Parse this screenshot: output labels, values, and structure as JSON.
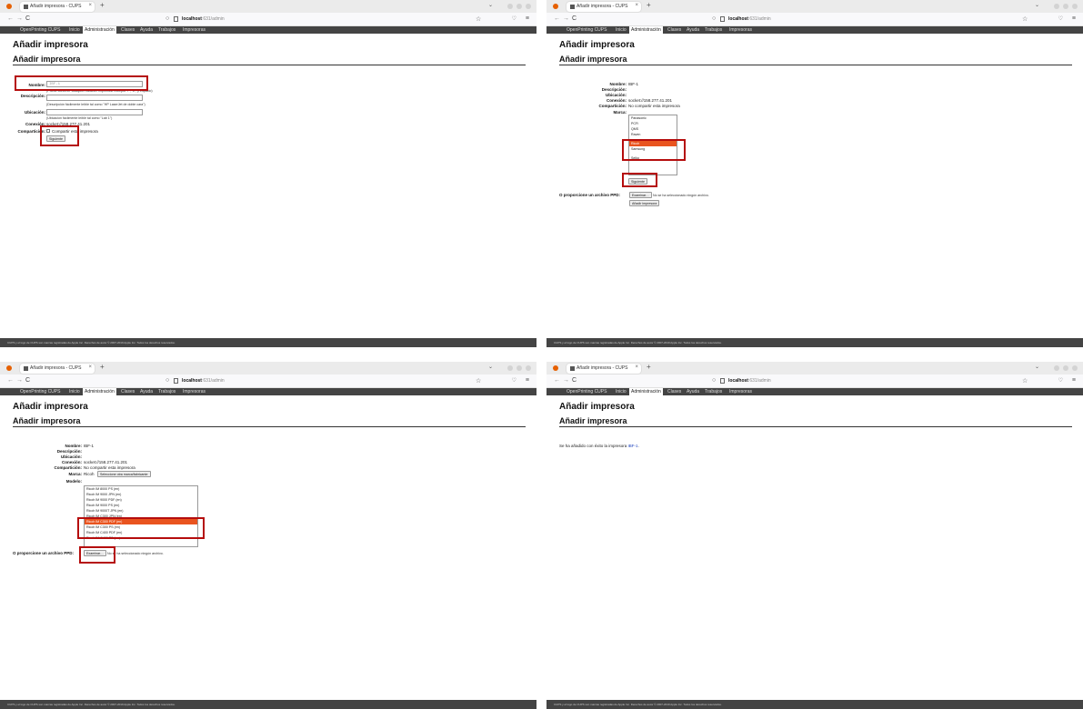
{
  "browser": {
    "tab_title": "Añadir impresora - CUPS",
    "tab_close": "×",
    "new_tab": "+",
    "tabs_menu": "⌄",
    "url_host": "localhost",
    "url_path": ":631/admin",
    "back": "←",
    "forward": "→",
    "reload": "C",
    "bookmark_star": "☆",
    "pocket": "♡",
    "menu": "≡"
  },
  "cups_nav": [
    "OpenPrinting CUPS",
    "Inicio",
    "Administración",
    "Clases",
    "Ayuda",
    "Trabajos",
    "Impresoras"
  ],
  "page": {
    "h1": "Añadir impresora",
    "h2": "Añadir impresora"
  },
  "labels": {
    "nombre": "Nombre:",
    "descripcion": "Descripción:",
    "ubicacion": "Ubicación:",
    "conexion": "Conexión:",
    "comparticion": "Compartición:",
    "marca": "Marca:",
    "modelo": "Modelo:",
    "ppd": "O proporcione un archivo PPD:"
  },
  "step1": {
    "nombre_value": "IBF-1",
    "nombre_hint": "(Puede contener cualquier carácter imprimible excepto \"/\", \"#\", y espacio)",
    "descripcion_hint": "(Descripción fácilmente leíble tal como \"HP LaserJet de doble cara\")",
    "ubicacion_hint": "(Ubicación fácilmente leíble tal como \"Lab 1\")",
    "conexion_value": "socket://158.277.41.201",
    "compartir_label": "Compartir esta impresora",
    "siguiente": "Siguiente"
  },
  "step2": {
    "nombre_value": "IBF-1",
    "conexion_value": "socket://158.277.41.201",
    "comparticion_value": "No compartir esta impresora",
    "marcas": [
      "Panasonic",
      "PCFi",
      "QMS",
      "Raven",
      "Ricoh",
      "Samsung",
      "Seiko"
    ],
    "marcas_selected": 4,
    "siguiente": "Siguiente",
    "examinar": "Examinar…",
    "no_file": "No se ha seleccionado ningún archivo.",
    "anadir": "Añadir impresora"
  },
  "step3": {
    "nombre_value": "IBF-1",
    "conexion_value": "socket://158.277.41.201",
    "comparticion_value": "No compartir esta impresora",
    "marca_value": "Ricoh",
    "otra_marca": "Seleccione otra marca/fabricante",
    "modelos": [
      "Ricoh IM 8000 PS (en)",
      "Ricoh IM 9000 JPN (en)",
      "Ricoh IM 9000 PDF (en)",
      "Ricoh IM 9000 PS (en)",
      "Ricoh IM 9000T JPN (en)",
      "Ricoh IM C300 JPN (en)",
      "Ricoh IM C300 PDF (en)",
      "Ricoh IM C300 PS (en)",
      "Ricoh IM C400 PDF (en)",
      "Ricoh IM C400 PS (en)"
    ],
    "modelos_selected": 6,
    "examinar": "Examinar…",
    "no_file": "No se ha seleccionado ningún archivo."
  },
  "step4": {
    "message_before": "Se ha añadido con éxito la impresora ",
    "printer_link": "IBF-1",
    "message_after": "."
  },
  "footer": "CUPS y el logo de CUPS son marcas registradas de Apple Inc. Derechos de autor © 2007-2019 Apple Inc. Todos los derechos reservados.",
  "colors": {
    "highlight": "#b50d0d",
    "selected_option": "#e9541f",
    "cups_bar": "#444444",
    "link": "#1a3fbd"
  }
}
